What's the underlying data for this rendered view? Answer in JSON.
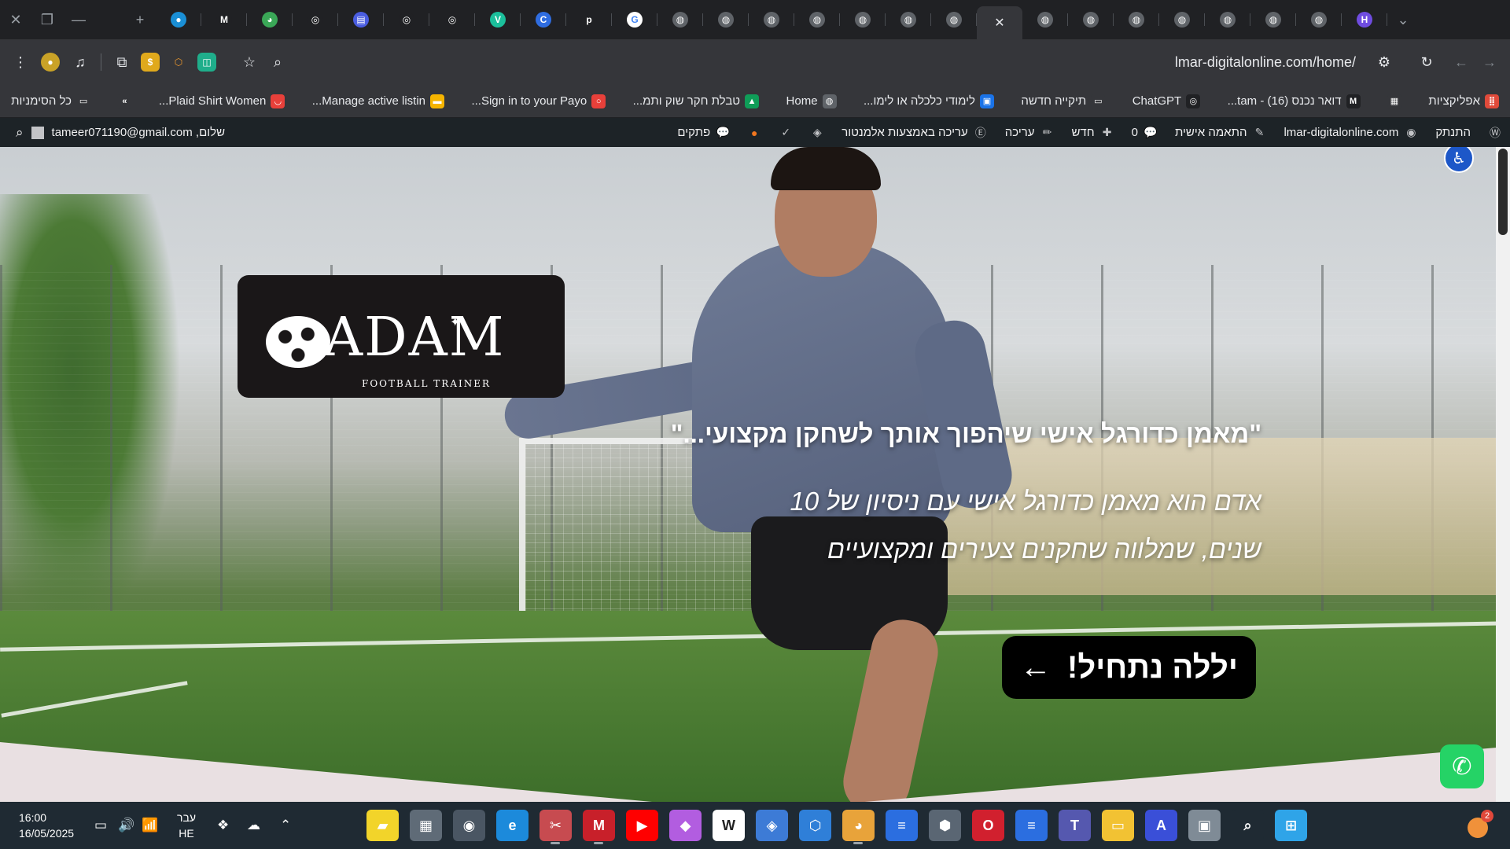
{
  "window": {
    "url": "lmar-digitalonline.com/home/"
  },
  "tabs": [
    {
      "name": "tab-bubble",
      "color": "#1a8fd6",
      "glyph": "●"
    },
    {
      "name": "tab-gmail",
      "color": "#202124",
      "glyph": "M"
    },
    {
      "name": "tab-chrome-store",
      "color": "#3aa757",
      "glyph": "◕"
    },
    {
      "name": "tab-chatgpt",
      "color": "#202124",
      "glyph": "◎"
    },
    {
      "name": "tab-calendar",
      "color": "#4a5de0",
      "glyph": "▤"
    },
    {
      "name": "tab-openai-1",
      "color": "#202124",
      "glyph": "◎"
    },
    {
      "name": "tab-openai-2",
      "color": "#202124",
      "glyph": "◎"
    },
    {
      "name": "tab-v-app",
      "color": "#1bbf9b",
      "glyph": "V"
    },
    {
      "name": "tab-c-app",
      "color": "#2f6de1",
      "glyph": "C"
    },
    {
      "name": "tab-p-app",
      "color": "#202124",
      "glyph": "p"
    },
    {
      "name": "tab-google",
      "color": "#ffffff",
      "glyph": "G"
    },
    {
      "name": "tab-site-1",
      "color": "#5f6368",
      "glyph": "◍"
    },
    {
      "name": "tab-site-2",
      "color": "#5f6368",
      "glyph": "◍"
    },
    {
      "name": "tab-site-3",
      "color": "#5f6368",
      "glyph": "◍"
    },
    {
      "name": "tab-site-4",
      "color": "#5f6368",
      "glyph": "◍"
    },
    {
      "name": "tab-site-5",
      "color": "#5f6368",
      "glyph": "◍"
    },
    {
      "name": "tab-site-6",
      "color": "#5f6368",
      "glyph": "◍"
    },
    {
      "name": "tab-site-7",
      "color": "#5f6368",
      "glyph": "◍"
    }
  ],
  "tabs_after": [
    {
      "name": "tab-site-8",
      "color": "#5f6368",
      "glyph": "◍"
    },
    {
      "name": "tab-site-9",
      "color": "#5f6368",
      "glyph": "◍"
    },
    {
      "name": "tab-site-10",
      "color": "#5f6368",
      "glyph": "◍"
    },
    {
      "name": "tab-site-11",
      "color": "#5f6368",
      "glyph": "◍"
    },
    {
      "name": "tab-site-12",
      "color": "#5f6368",
      "glyph": "◍"
    },
    {
      "name": "tab-site-13",
      "color": "#5f6368",
      "glyph": "◍"
    },
    {
      "name": "tab-site-14",
      "color": "#5f6368",
      "glyph": "◍"
    },
    {
      "name": "tab-h-app",
      "color": "#6f4ce0",
      "glyph": "H"
    }
  ],
  "active_tab_glyph": "✕",
  "bookmarks": [
    {
      "label": "אפליקציות",
      "color": "#e04a3a",
      "glyph": "⣿",
      "name": "bookmark-apps"
    },
    {
      "label": "",
      "color": "#35363a",
      "glyph": "▦",
      "name": "bookmark-grid"
    },
    {
      "label": "דואר נכנס (16) - tam...",
      "color": "#202124",
      "glyph": "M",
      "name": "bookmark-gmail"
    },
    {
      "label": "ChatGPT",
      "color": "#202124",
      "glyph": "◎",
      "name": "bookmark-chatgpt"
    },
    {
      "label": "תיקייה חדשה",
      "color": "#35363a",
      "glyph": "▭",
      "name": "bookmark-new-folder"
    },
    {
      "label": "לימודי כלכלה או לימו...",
      "color": "#1a73e8",
      "glyph": "▣",
      "name": "bookmark-economics"
    },
    {
      "label": "Home",
      "color": "#5f6368",
      "glyph": "◍",
      "name": "bookmark-home"
    },
    {
      "label": "טבלת חקר שוק ותמ...",
      "color": "#0f9d58",
      "glyph": "▲",
      "name": "bookmark-market-research"
    },
    {
      "label": "Sign in to your Payo...",
      "color": "#e8403a",
      "glyph": "○",
      "name": "bookmark-payoneer"
    },
    {
      "label": "Manage active listin...",
      "color": "#f5b400",
      "glyph": "▬",
      "name": "bookmark-listings"
    },
    {
      "label": "Plaid Shirt Women...",
      "color": "#e8403a",
      "glyph": "◡",
      "name": "bookmark-plaid-shirt"
    },
    {
      "label": "",
      "color": "#35363a",
      "glyph": "»",
      "name": "bookmark-overflow"
    },
    {
      "label": "כל הסימניות",
      "color": "#35363a",
      "glyph": "▭",
      "name": "bookmark-all"
    }
  ],
  "adminbar": {
    "items": [
      {
        "label": "",
        "glyph": "Ⓦ",
        "name": "wp-logo"
      },
      {
        "label": "התנתק",
        "glyph": "",
        "name": "wp-logout"
      },
      {
        "label": "lmar-digitalonline.com",
        "glyph": "◉",
        "name": "wp-site-name"
      },
      {
        "label": "התאמה אישית",
        "glyph": "✎",
        "name": "wp-customize"
      },
      {
        "label": "0",
        "glyph": "💬",
        "name": "wp-comments"
      },
      {
        "label": "חדש",
        "glyph": "✚",
        "name": "wp-new"
      },
      {
        "label": "עריכה",
        "glyph": "✏",
        "name": "wp-edit"
      },
      {
        "label": "עריכה באמצעות אלמנטור",
        "glyph": "Ⓔ",
        "name": "wp-elementor"
      },
      {
        "label": "",
        "glyph": "◈",
        "name": "wp-diamond"
      },
      {
        "label": "",
        "glyph": "✓",
        "name": "wp-yoast"
      },
      {
        "label": "",
        "glyph": "●",
        "name": "wp-status-dot"
      },
      {
        "label": "פתקים",
        "glyph": "💬",
        "name": "wp-notes"
      }
    ],
    "greeting": "שלום, tameer071190@gmail.com"
  },
  "hero": {
    "logo_word": "ADAM",
    "logo_sub": "FOOTBALL TRAINER",
    "quote": "\"מאמן כדורגל אישי שיהפוך אותך לשחקן מקצועי...\"",
    "description": "אדם הוא מאמן כדורגל אישי עם ניסיון של 10 שנים, שמלווה שחקנים צעירים ומקצועיים",
    "cta_label": "יללה נתחיל!",
    "cta_arrow": "←"
  },
  "taskbar": {
    "time": "16:00",
    "date": "16/05/2025",
    "lang_line1": "עבר",
    "lang_line2": "HE",
    "apps": [
      {
        "name": "sticky-notes-app",
        "color": "#f2d42a",
        "glyph": "▰"
      },
      {
        "name": "calculator-app",
        "color": "#5f6b77",
        "glyph": "▦"
      },
      {
        "name": "camera-app",
        "color": "#4a5663",
        "glyph": "◉"
      },
      {
        "name": "edge-app",
        "color": "#1c8adb",
        "glyph": "e"
      },
      {
        "name": "snipping-app",
        "color": "#c74b50",
        "glyph": "✂"
      },
      {
        "name": "mcafee-app",
        "color": "#c8202a",
        "glyph": "M"
      },
      {
        "name": "youtube-app",
        "color": "#ff0000",
        "glyph": "▶"
      },
      {
        "name": "copilot-app",
        "color": "#b25de0",
        "glyph": "◆"
      },
      {
        "name": "wikipedia-app",
        "color": "#ffffff",
        "glyph": "W"
      },
      {
        "name": "game-app",
        "color": "#3d7bd6",
        "glyph": "◈"
      },
      {
        "name": "box-app",
        "color": "#2f7fd8",
        "glyph": "⬡"
      },
      {
        "name": "chrome-app",
        "color": "#e8a33a",
        "glyph": "◕"
      },
      {
        "name": "docs-app",
        "color": "#2b6ee0",
        "glyph": "≡"
      },
      {
        "name": "cube-app",
        "color": "#5a6673",
        "glyph": "⬢"
      },
      {
        "name": "opera-app",
        "color": "#d1202e",
        "glyph": "O"
      },
      {
        "name": "docs2-app",
        "color": "#2b6ee0",
        "glyph": "≡"
      },
      {
        "name": "teams-app",
        "color": "#5558af",
        "glyph": "T"
      },
      {
        "name": "explorer-app",
        "color": "#f2c233",
        "glyph": "▭"
      },
      {
        "name": "word-app",
        "color": "#3a4fd8",
        "glyph": "A"
      },
      {
        "name": "windows-copy-app",
        "color": "#7f8b96",
        "glyph": "▣"
      },
      {
        "name": "search-app",
        "color": "#1f2a33",
        "glyph": "⌕"
      },
      {
        "name": "start-app",
        "color": "#2fa4e8",
        "glyph": "⊞"
      }
    ],
    "notif_count": "2"
  }
}
